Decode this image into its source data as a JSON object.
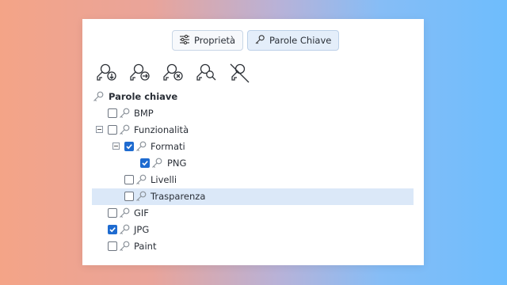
{
  "tabs": [
    {
      "label": "Proprietà",
      "icon": "sliders-icon",
      "active": false
    },
    {
      "label": "Parole Chiave",
      "icon": "key-icon",
      "active": true
    }
  ],
  "toolbar": [
    {
      "name": "add-keyword-button",
      "icon": "key-arrow-down-icon"
    },
    {
      "name": "apply-keyword-button",
      "icon": "key-arrow-right-icon"
    },
    {
      "name": "remove-keyword-button",
      "icon": "key-x-icon"
    },
    {
      "name": "search-keyword-button",
      "icon": "key-search-icon"
    },
    {
      "name": "disable-keyword-button",
      "icon": "key-slash-icon"
    }
  ],
  "tree": {
    "root_label": "Parole chiave",
    "items": [
      {
        "label": "BMP",
        "checked": false
      },
      {
        "label": "Funzionalità",
        "checked": false,
        "expanded": true
      },
      {
        "label": "Formati",
        "checked": true,
        "expanded": true
      },
      {
        "label": "PNG",
        "checked": true
      },
      {
        "label": "Livelli",
        "checked": false
      },
      {
        "label": "Trasparenza",
        "checked": false,
        "selected": true
      },
      {
        "label": "GIF",
        "checked": false
      },
      {
        "label": "JPG",
        "checked": true
      },
      {
        "label": "Paint",
        "checked": false
      }
    ]
  },
  "colors": {
    "accent": "#1e6bd0",
    "selection": "#dbe8f8"
  }
}
